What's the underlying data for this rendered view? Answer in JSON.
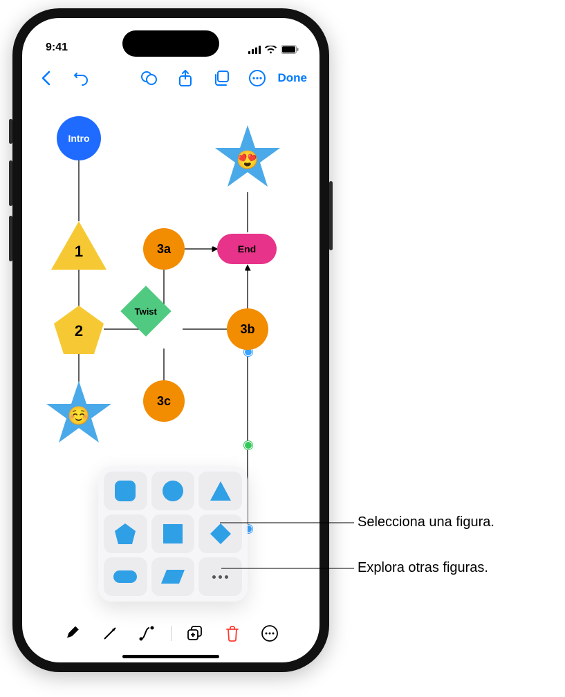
{
  "status": {
    "time": "9:41"
  },
  "toolbar": {
    "done_label": "Done"
  },
  "nodes": {
    "intro": "Intro",
    "n1": "1",
    "n2": "2",
    "n3a": "3a",
    "n3b": "3b",
    "n3c": "3c",
    "twist": "Twist",
    "end": "End",
    "emoji_smile": "☺️",
    "emoji_hearteyes": "😍"
  },
  "shape_picker": {
    "icons": [
      "rounded-square",
      "circle",
      "triangle",
      "pentagon",
      "square",
      "diamond",
      "pill",
      "parallelogram",
      "more"
    ]
  },
  "callouts": {
    "select_shape": "Selecciona una figura.",
    "explore_shapes": "Explora otras figuras."
  }
}
